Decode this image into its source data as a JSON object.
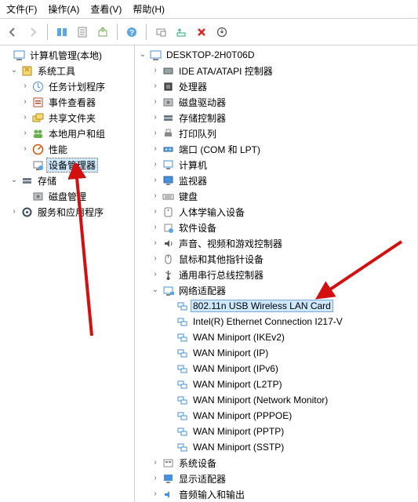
{
  "menu": {
    "file": "文件(F)",
    "action": "操作(A)",
    "view": "查看(V)",
    "help": "帮助(H)"
  },
  "left_root": "计算机管理(本地)",
  "left_tree": [
    {
      "label": "系统工具",
      "expanded": true,
      "icon": "tools",
      "children": [
        {
          "label": "任务计划程序",
          "icon": "clock",
          "tw": "right"
        },
        {
          "label": "事件查看器",
          "icon": "event",
          "tw": "right"
        },
        {
          "label": "共享文件夹",
          "icon": "share",
          "tw": "right"
        },
        {
          "label": "本地用户和组",
          "icon": "users",
          "tw": "right"
        },
        {
          "label": "性能",
          "icon": "perf",
          "tw": "right"
        },
        {
          "label": "设备管理器",
          "icon": "device",
          "tw": "none",
          "selected": true
        }
      ]
    },
    {
      "label": "存储",
      "expanded": true,
      "icon": "storage",
      "children": [
        {
          "label": "磁盘管理",
          "icon": "disk",
          "tw": "none"
        }
      ]
    },
    {
      "label": "服务和应用程序",
      "expanded": false,
      "icon": "services",
      "tw": "right"
    }
  ],
  "right_root": "DESKTOP-2H0T06D",
  "right_categories": [
    {
      "label": "IDE ATA/ATAPI 控制器",
      "icon": "ide"
    },
    {
      "label": "处理器",
      "icon": "cpu"
    },
    {
      "label": "磁盘驱动器",
      "icon": "disk"
    },
    {
      "label": "存储控制器",
      "icon": "storage"
    },
    {
      "label": "打印队列",
      "icon": "printer"
    },
    {
      "label": "端口 (COM 和 LPT)",
      "icon": "port"
    },
    {
      "label": "计算机",
      "icon": "computer"
    },
    {
      "label": "监视器",
      "icon": "monitor"
    },
    {
      "label": "键盘",
      "icon": "keyboard"
    },
    {
      "label": "人体学输入设备",
      "icon": "hid"
    },
    {
      "label": "软件设备",
      "icon": "soft"
    },
    {
      "label": "声音、视频和游戏控制器",
      "icon": "sound"
    },
    {
      "label": "鼠标和其他指针设备",
      "icon": "mouse"
    },
    {
      "label": "通用串行总线控制器",
      "icon": "usb"
    }
  ],
  "network_label": "网络适配器",
  "network_adapters": [
    {
      "label": "802.11n USB Wireless LAN Card",
      "highlight": true
    },
    {
      "label": "Intel(R) Ethernet Connection I217-V"
    },
    {
      "label": "WAN Miniport (IKEv2)"
    },
    {
      "label": "WAN Miniport (IP)"
    },
    {
      "label": "WAN Miniport (IPv6)"
    },
    {
      "label": "WAN Miniport (L2TP)"
    },
    {
      "label": "WAN Miniport (Network Monitor)"
    },
    {
      "label": "WAN Miniport (PPPOE)"
    },
    {
      "label": "WAN Miniport (PPTP)"
    },
    {
      "label": "WAN Miniport (SSTP)"
    }
  ],
  "right_categories_after": [
    {
      "label": "系统设备",
      "icon": "sysdev"
    },
    {
      "label": "显示适配器",
      "icon": "display"
    },
    {
      "label": "音频输入和输出",
      "icon": "audio"
    }
  ]
}
